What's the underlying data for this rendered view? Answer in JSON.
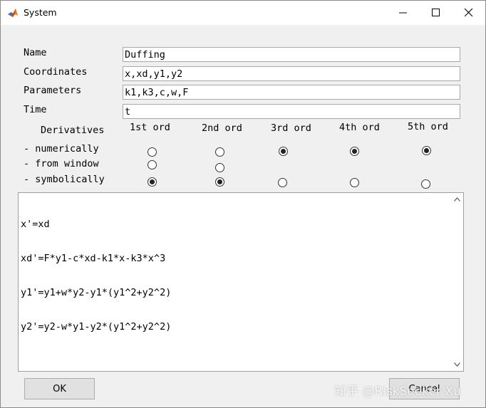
{
  "window": {
    "title": "System",
    "controls": {
      "minimize": "minimize-icon",
      "maximize": "maximize-icon",
      "close": "close-icon"
    }
  },
  "form": {
    "name_label": "Name",
    "name_value": "Duffing",
    "coords_label": "Coordinates",
    "coords_value": "x,xd,y1,y2",
    "params_label": "Parameters",
    "params_value": "k1,k3,c,w,F",
    "time_label": "Time",
    "time_value": "t"
  },
  "derivatives": {
    "header": "Derivatives",
    "orders": [
      "1st ord",
      "2nd ord",
      "3rd ord",
      "4th ord",
      "5th ord"
    ],
    "rows": [
      {
        "label": "- numerically",
        "selected": [
          false,
          false,
          true,
          true,
          true
        ]
      },
      {
        "label": "- from window",
        "selected": [
          false,
          false
        ]
      },
      {
        "label": "- symbolically",
        "selected": [
          true,
          true,
          false,
          false,
          false
        ]
      }
    ]
  },
  "equations": [
    "x'=xd",
    "xd'=F*y1-c*xd-k1*x-k3*x^3",
    "y1'=y1+w*y2-y1*(y1^2+y2^2)",
    "y2'=y2-w*y1-y2*(y1^2+y2^2)"
  ],
  "buttons": {
    "ok": "OK",
    "cancel": "Cancel"
  },
  "watermark": "知乎 @RiskSeeker Xu"
}
